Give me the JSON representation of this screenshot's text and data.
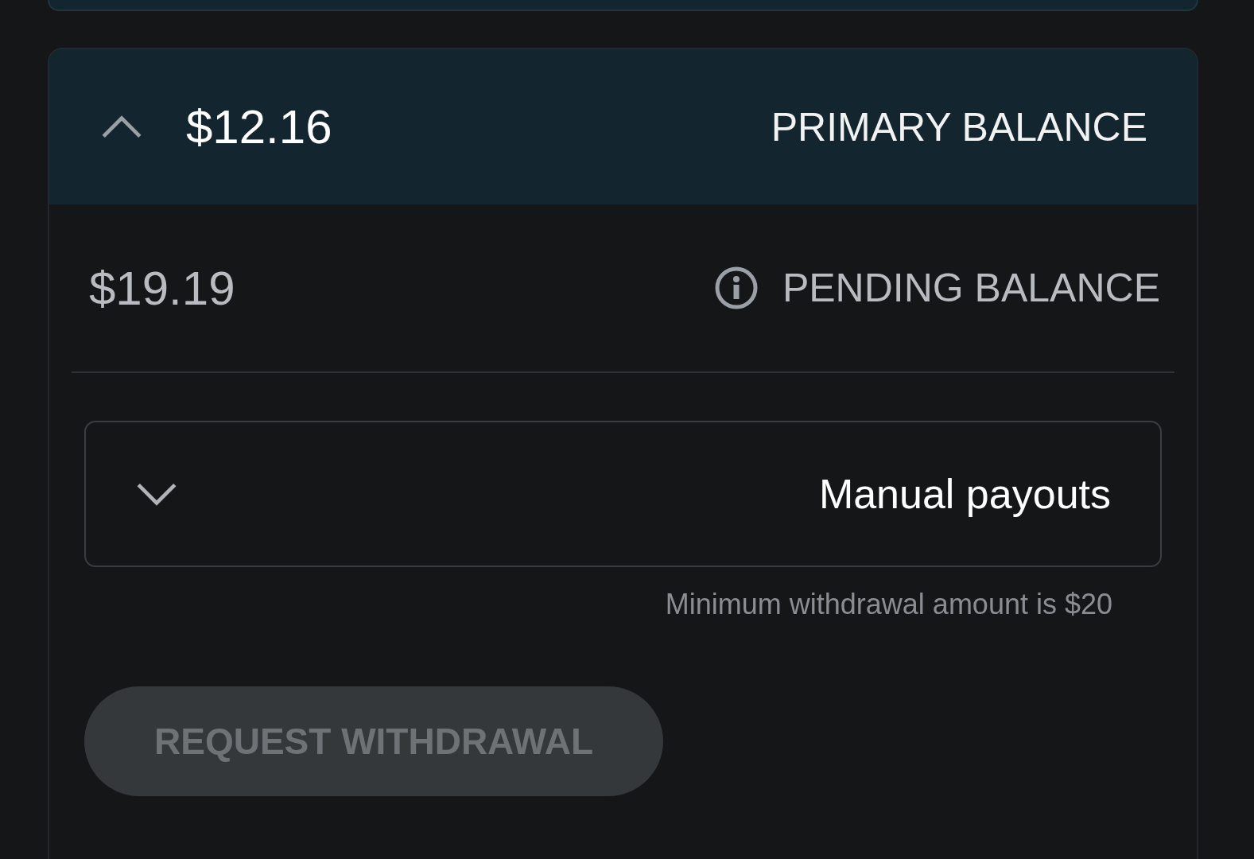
{
  "primary_balance": {
    "label": "PRIMARY BALANCE",
    "amount": "$12.16",
    "expanded": true
  },
  "pending_balance": {
    "label": "PENDING BALANCE",
    "amount": "$19.19"
  },
  "payout_select": {
    "value": "Manual payouts",
    "hint": "Minimum withdrawal amount is $20"
  },
  "withdraw_button": {
    "label": "REQUEST WITHDRAWAL",
    "disabled": true
  }
}
